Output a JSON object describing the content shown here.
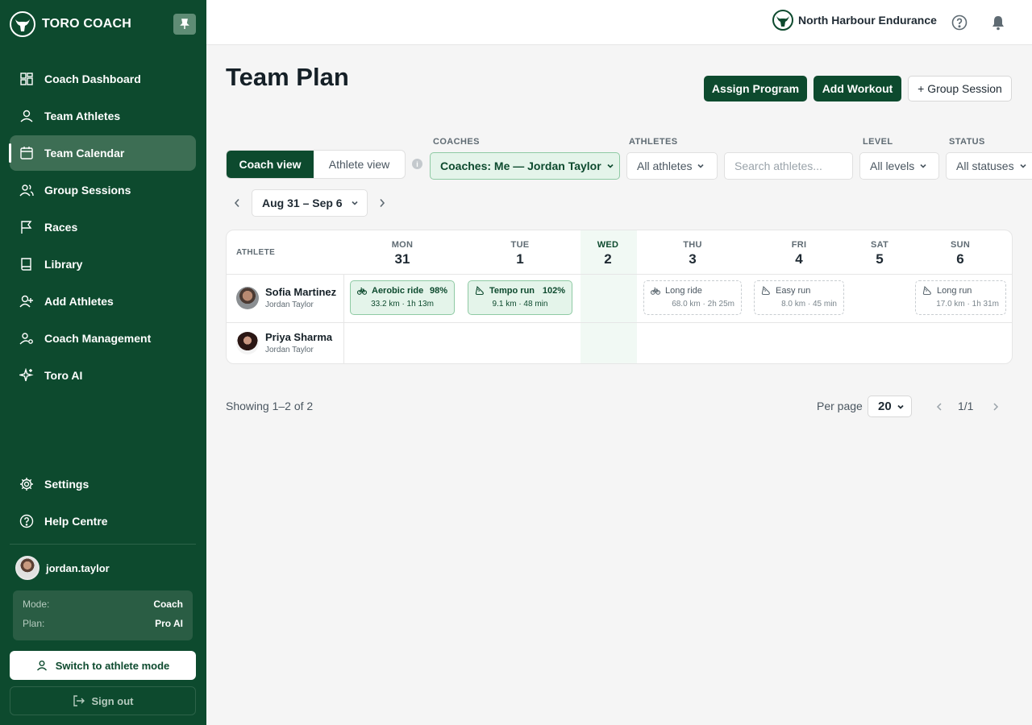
{
  "brand": {
    "name": "TORO COACH"
  },
  "sidebar": {
    "items": [
      {
        "label": "Coach Dashboard",
        "icon": "dashboard-icon"
      },
      {
        "label": "Team Athletes",
        "icon": "user-icon"
      },
      {
        "label": "Team Calendar",
        "icon": "calendar-icon",
        "active": true
      },
      {
        "label": "Group Sessions",
        "icon": "users-icon"
      },
      {
        "label": "Races",
        "icon": "flag-icon"
      },
      {
        "label": "Library",
        "icon": "book-icon"
      },
      {
        "label": "Add Athletes",
        "icon": "user-plus-icon"
      },
      {
        "label": "Coach Management",
        "icon": "user-cog-icon"
      },
      {
        "label": "Toro AI",
        "icon": "sparkle-icon"
      }
    ],
    "bottom_items": [
      {
        "label": "Settings",
        "icon": "gear-icon"
      },
      {
        "label": "Help Centre",
        "icon": "help-icon"
      }
    ],
    "user": {
      "username": "jordan.taylor"
    },
    "plan": {
      "mode_label": "Mode:",
      "mode_value": "Coach",
      "plan_label": "Plan:",
      "plan_value": "Pro AI"
    },
    "switch_label": "Switch to athlete mode",
    "signout_label": "Sign out"
  },
  "topbar": {
    "org_name": "North Harbour Endurance"
  },
  "page": {
    "title": "Team Plan",
    "actions": {
      "assign": "Assign Program",
      "add": "Add Workout",
      "group": "+ Group Session"
    }
  },
  "views": {
    "coach": "Coach view",
    "athlete": "Athlete view"
  },
  "filters": {
    "coaches": {
      "label": "COACHES",
      "value": "Coaches: Me — Jordan Taylor"
    },
    "athletes": {
      "label": "ATHLETES",
      "value": "All athletes"
    },
    "search": {
      "placeholder": "Search athletes..."
    },
    "level": {
      "label": "LEVEL",
      "value": "All levels"
    },
    "status": {
      "label": "STATUS",
      "value": "All statuses"
    }
  },
  "date_range": "Aug 31 – Sep 6",
  "calendar": {
    "athlete_header": "ATHLETE",
    "days": [
      {
        "name": "MON",
        "num": "31"
      },
      {
        "name": "TUE",
        "num": "1"
      },
      {
        "name": "WED",
        "num": "2"
      },
      {
        "name": "THU",
        "num": "3"
      },
      {
        "name": "FRI",
        "num": "4"
      },
      {
        "name": "SAT",
        "num": "5"
      },
      {
        "name": "SUN",
        "num": "6"
      }
    ],
    "athletes": [
      {
        "name": "Sofia Martinez",
        "coach": "Jordan Taylor",
        "workouts": [
          {
            "title": "Aerobic ride",
            "pct": "98%",
            "detail": "33.2 km · 1h 13m",
            "sport": "bike-icon",
            "state": "done"
          },
          {
            "title": "Tempo run",
            "pct": "102%",
            "detail": "9.1 km · 48 min",
            "sport": "shoe-icon",
            "state": "done"
          },
          {
            "title": "Long ride",
            "pct": "",
            "detail": "68.0 km · 2h 25m",
            "sport": "bike-icon",
            "state": "planned"
          },
          {
            "title": "Easy run",
            "pct": "",
            "detail": "8.0 km · 45 min",
            "sport": "shoe-icon",
            "state": "planned"
          },
          {
            "title": "Long run",
            "pct": "",
            "detail": "17.0 km · 1h 31m",
            "sport": "shoe-icon",
            "state": "planned"
          }
        ]
      },
      {
        "name": "Priya Sharma",
        "coach": "Jordan Taylor",
        "workouts": []
      }
    ]
  },
  "pagination": {
    "showing": "Showing 1–2 of 2",
    "per_page_label": "Per page",
    "per_page_value": "20",
    "page_text": "1/1"
  },
  "colors": {
    "brand": "#0d4a2e",
    "accent_bg": "#e4f4ea",
    "accent_border": "#8fcaa4"
  }
}
